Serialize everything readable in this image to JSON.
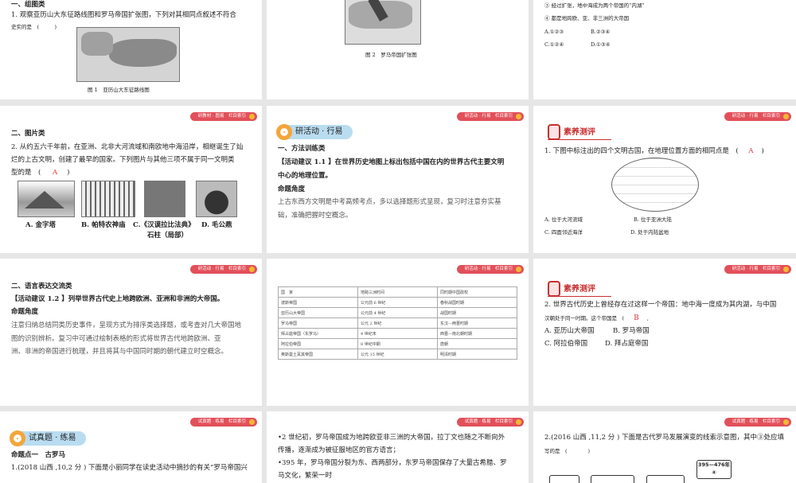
{
  "slides": {
    "s1": {
      "section": "一、组图类",
      "q": "1. 观察亚历山大东征路线图和罗马帝国扩张图，下列对其相同点叙述不符合",
      "q2": "史实的是　(　　　)",
      "caption": "图 1　亚历山大东征路线图"
    },
    "s2": {
      "caption": "图 2　罗马帝国扩张图"
    },
    "s3": {
      "o3": "③ 经过扩张，地中海成为两个帝国的“内湖”",
      "o4": "④ 都是地跨欧、亚、非三洲的大帝国",
      "a": "A.①②③",
      "b": "B.②③④",
      "c": "C.①②④",
      "d": "D.①③④"
    },
    "s4": {
      "tag": "研教材 · 图易　栏目索引",
      "section": "二、图片类",
      "l1": "2. 从约五六千年前，在亚洲、北非大河流域和南欧地中海沿岸，相继诞生了灿",
      "l2": "烂的上古文明，创建了最早的国家。下列图片与其他三项不属于同一文明类",
      "l3": "型的是　(",
      "answer": "A",
      "captions": [
        "A. 金字塔",
        "B. 帕特农神庙",
        "C.《汉谟拉比法典》",
        "D. 毛公鼎"
      ],
      "c_extra": "石柱（局部）"
    },
    "s5": {
      "tag": "研活动 · 行易　栏目索引",
      "banner": "研活动 · 行易",
      "section": "一、方法训练类",
      "l1": "【活动建议 1.1 】在世界历史地图上标出包括中国在内的世界古代主要文明",
      "l2": "中心的地理位置。",
      "h": "命题角度",
      "p1": "上古东西方文明是中考高频考点，多以选择题形式呈现，复习时注意夯实基",
      "p2": "础，准确把握时空概念。"
    },
    "s6": {
      "tag": "研活动 · 行易　栏目索引",
      "badge": "素养测评",
      "q": "1. 下图中标注出的四个文明古国，在地理位置方面的相同点是　(",
      "answer": "A",
      "a": "A. 位于大河流域",
      "b": "B. 位于亚洲大陆",
      "c": "C. 四面邻近海洋",
      "d": "D. 处于内陆盆地"
    },
    "s7": {
      "tag": "研活动 · 行易　栏目索引",
      "section": "二、语言表达交流类",
      "l1": "【活动建议 1.2 】列举世界古代史上地跨欧洲、亚洲和非洲的大帝国。",
      "h": "命题角度",
      "p1": "注意归纳总结同类历史事件，呈现方式为排序类选择题，或考查对几大帝国地",
      "p2": "图的识别辨析。复习中可通过绘制表格的形式将世界古代地跨欧洲、亚",
      "p3": "洲、非洲的帝国进行梳理，并且将其与中国同时期的朝代建立时空概念。"
    },
    "s8": {
      "tag": "研活动 · 行易　栏目索引",
      "table": [
        [
          "国　家",
          "地跨三洲时间",
          "同时期中国政权"
        ],
        [
          "波斯帝国",
          "公元前 6 世纪",
          "春秋战国时期"
        ],
        [
          "亚历山大帝国",
          "公元前 4 世纪",
          "战国时期"
        ],
        [
          "罗马帝国",
          "公元 2 世纪",
          "东汉—两晋时期"
        ],
        [
          "拜占庭帝国（东罗马）",
          "4 世纪末",
          "西晋—南北朝时期"
        ],
        [
          "阿拉伯帝国",
          "8 世纪中期",
          "唐朝"
        ],
        [
          "奥斯曼土耳其帝国",
          "公元 15 世纪",
          "明清时期"
        ]
      ]
    },
    "s9": {
      "tag": "研活动 · 行易　栏目索引",
      "badge": "素养测评",
      "l1": "2. 世界古代历史上曾经存在过这样一个帝国：地中海一度成为其内湖，与中国",
      "l2": "汉朝处于同一时期。这个帝国是　(",
      "answer": "B",
      "a": "A. 亚历山大帝国",
      "b": "B. 罗马帝国",
      "c": "C. 阿拉伯帝国",
      "d": "D. 拜占庭帝国"
    },
    "s10": {
      "tag": "试真题 · 练易　栏目索引",
      "banner": "试真题 · 练易",
      "h": "命题点一　古罗马",
      "l1": "1.(2018 山西 ,10,2 分 ) 下面是小丽同学在读史活动中摘抄的有关“罗马帝国兴"
    },
    "s11": {
      "tag": "试真题 · 练易　栏目索引",
      "l1": "•2 世纪初，罗马帝国成为地跨欧亚非三洲的大帝国，拉丁文也随之不断向外",
      "l2": "传播，逐渐成为被征服地区的官方语言；",
      "l3": "•395 年，罗马帝国分裂为东、西两部分，东罗马帝国保存了大量古希腊、罗",
      "l4": "马文化，繁荣一时"
    },
    "s12": {
      "tag": "试真题 · 练易　栏目索引",
      "l1": "2.(2016 山西 ,11,2 分 ) 下面是古代罗马发展演变的线索示意图，其中③处应填",
      "l2": "写的是　(　　　　)",
      "box_year": "395—476年",
      "box_num": "④"
    }
  }
}
